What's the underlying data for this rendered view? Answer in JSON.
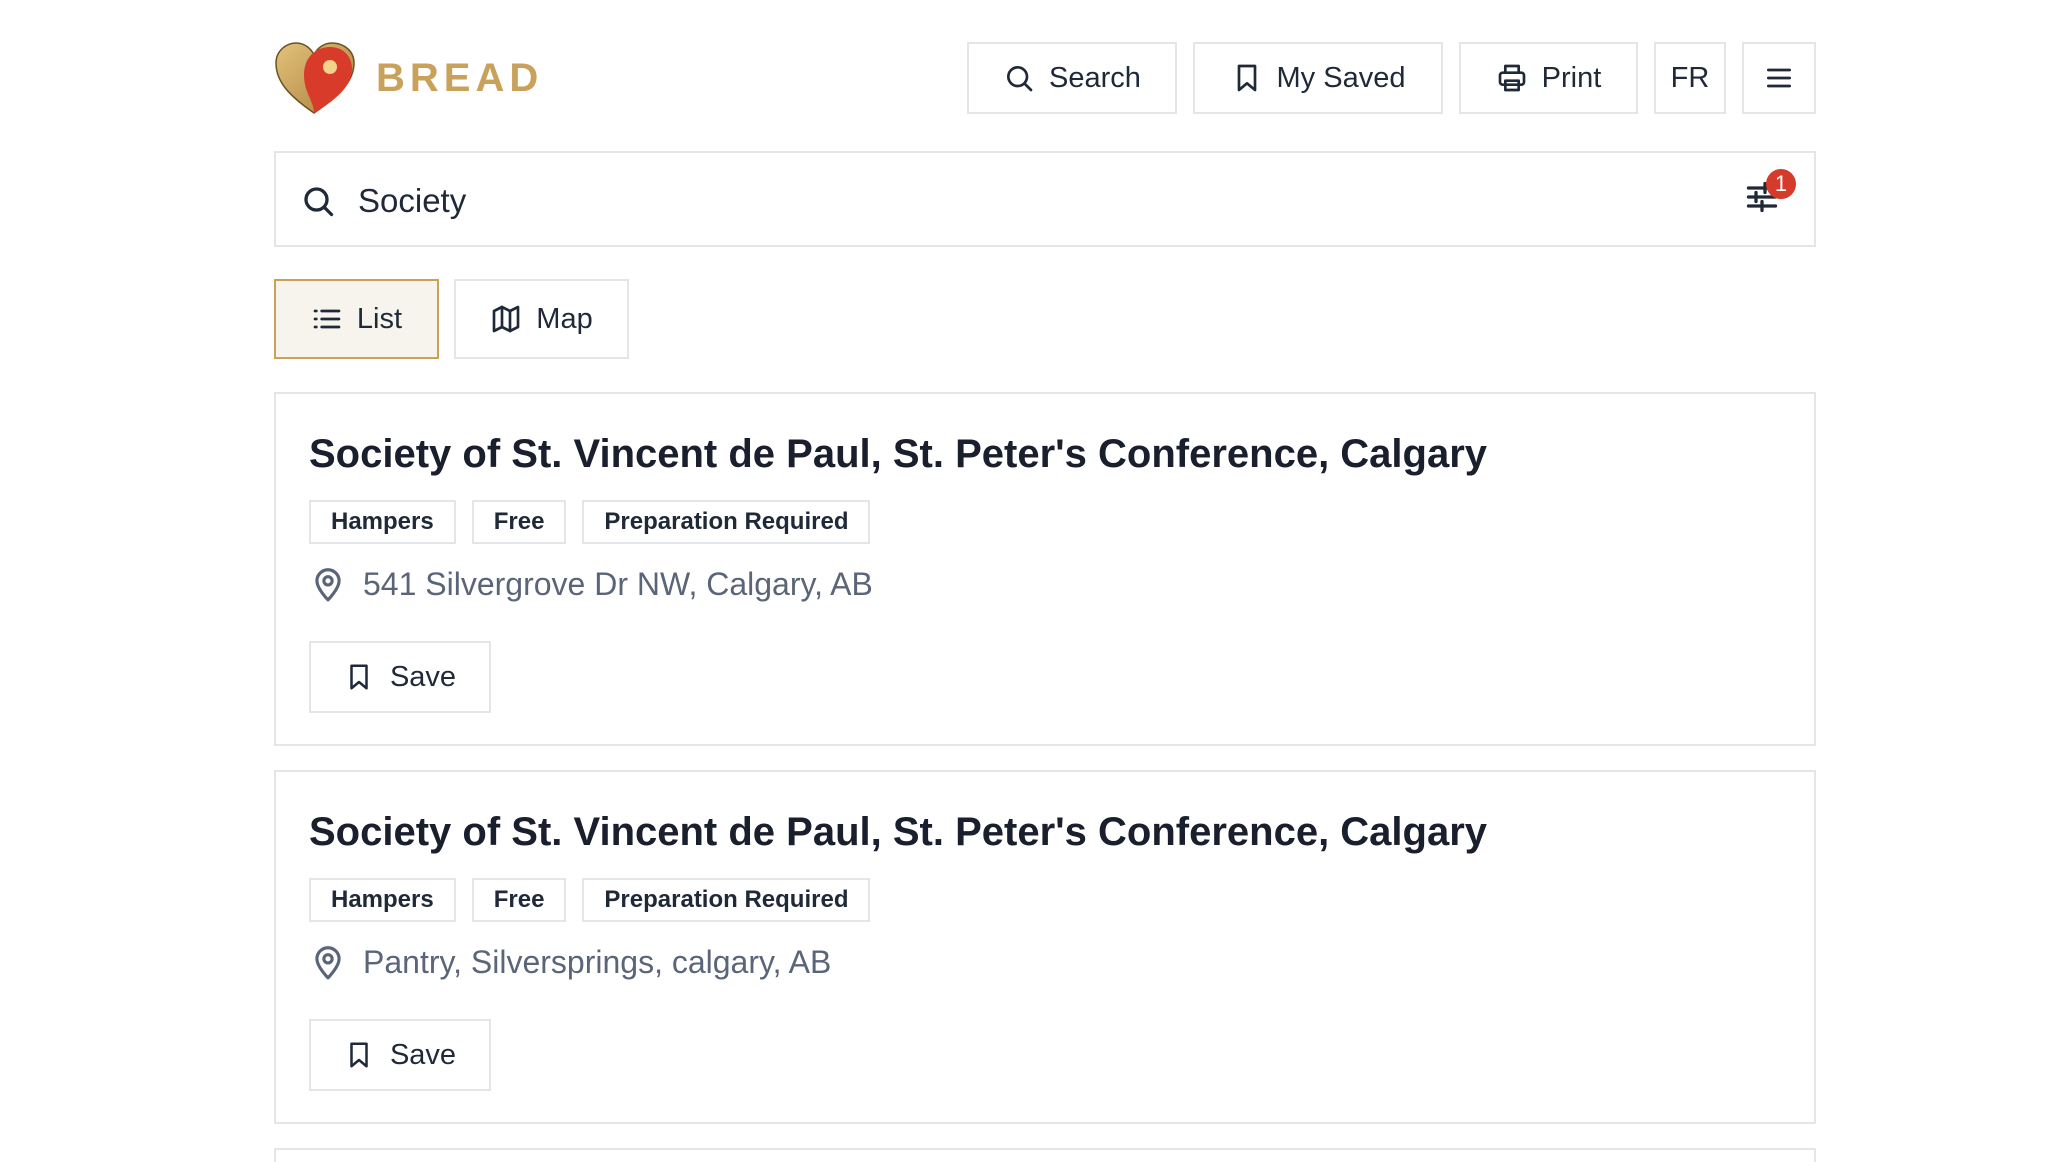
{
  "header": {
    "logo_text": "BREAD",
    "buttons": {
      "search": "Search",
      "my_saved": "My Saved",
      "print": "Print",
      "language": "FR"
    }
  },
  "search": {
    "value": "Society",
    "filter_count": "1"
  },
  "view_toggle": {
    "list": "List",
    "map": "Map",
    "active": "list"
  },
  "results": [
    {
      "title": "Society of St. Vincent de Paul, St. Peter's Conference, Calgary",
      "tags": [
        "Hampers",
        "Free",
        "Preparation Required"
      ],
      "address": "541 Silvergrove Dr NW, Calgary, AB",
      "save_label": "Save"
    },
    {
      "title": "Society of St. Vincent de Paul, St. Peter's Conference, Calgary",
      "tags": [
        "Hampers",
        "Free",
        "Preparation Required"
      ],
      "address": "Pantry, Silversprings, calgary, AB",
      "save_label": "Save"
    }
  ],
  "colors": {
    "brand_gold": "#c9a15a",
    "brand_red": "#d63a2b",
    "active_bg": "#f7f4ee",
    "border": "#e3e5e8",
    "address_text": "#5b6578"
  },
  "icons": {
    "logo": "heart-pin-logo",
    "search": "search-icon",
    "saved": "bookmark-icon",
    "print": "printer-icon",
    "menu": "hamburger-menu-icon",
    "filter": "sliders-icon",
    "list": "list-icon",
    "map": "map-icon",
    "location": "map-pin-icon"
  }
}
